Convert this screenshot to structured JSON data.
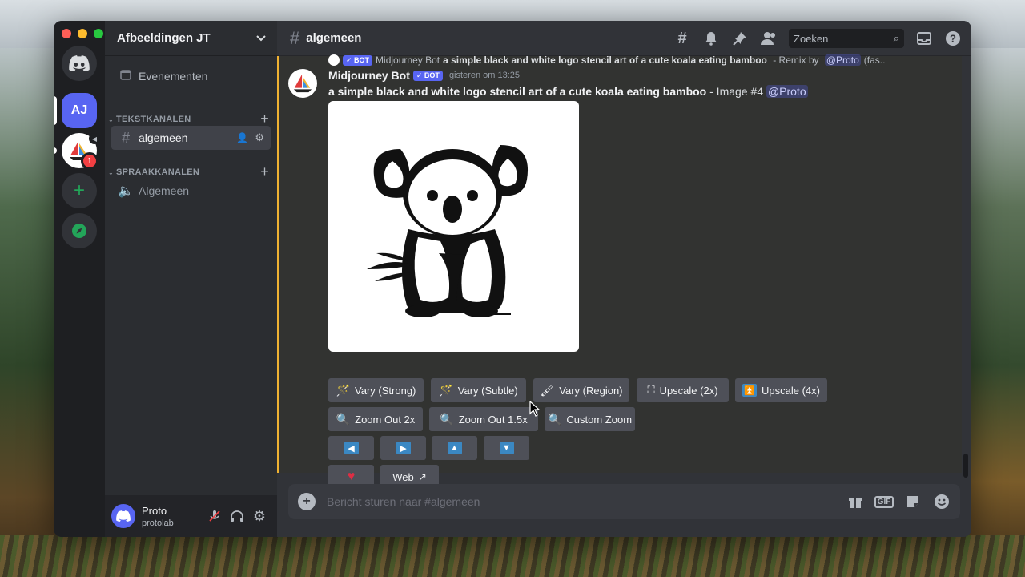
{
  "server": {
    "name": "Afbeeldingen JT"
  },
  "guilds": [
    {
      "label": "AJ"
    },
    {
      "badge": "1"
    }
  ],
  "sidebar": {
    "events_label": "Evenementen",
    "text_category": "TEKSTKANALEN",
    "voice_category": "SPRAAKKANALEN",
    "text_channel": "algemeen",
    "voice_channel": "Algemeen"
  },
  "user": {
    "name": "Proto",
    "sub": "protolab"
  },
  "topbar": {
    "channel": "algemeen",
    "search_placeholder": "Zoeken"
  },
  "reply": {
    "bot_tag": "✓ BOT",
    "author": "Midjourney Bot",
    "prompt": "a simple black and white logo stencil art of a cute koala eating bamboo",
    "suffix": " - Remix by ",
    "mention": "@Proto",
    "trail": "(fas.."
  },
  "message": {
    "author": "Midjourney Bot",
    "bot_tag": "✓ BOT",
    "time": "gisteren om 13:25",
    "prompt": "a simple black and white logo stencil art of a cute koala eating bamboo",
    "suffix": " - Image #4 ",
    "mention": "@Proto"
  },
  "buttons": {
    "vary_strong": "Vary (Strong)",
    "vary_subtle": "Vary (Subtle)",
    "vary_region": "Vary (Region)",
    "upscale_2x": "Upscale (2x)",
    "upscale_4x": "Upscale (4x)",
    "zoom_2x": "Zoom Out 2x",
    "zoom_15x": "Zoom Out 1.5x",
    "custom_zoom": "Custom Zoom",
    "web": "Web"
  },
  "composer": {
    "placeholder": "Bericht sturen naar #algemeen",
    "gif": "GIF"
  },
  "colors": {
    "accent": "#5865f2",
    "highlight": "#f0b232",
    "online": "#23a559"
  }
}
